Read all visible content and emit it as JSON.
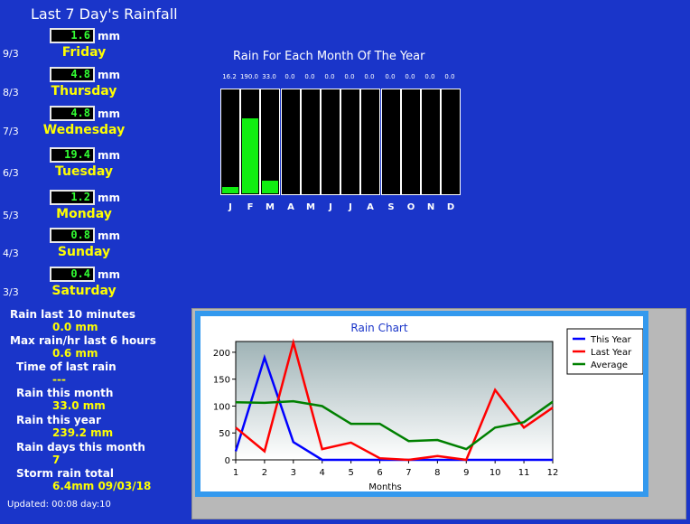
{
  "header": {
    "title": "Last 7 Day's Rainfall"
  },
  "days": [
    {
      "date": "9/3",
      "value": "1.6",
      "unit": "mm",
      "day": "Friday"
    },
    {
      "date": "8/3",
      "value": "4.8",
      "unit": "mm",
      "day": "Thursday"
    },
    {
      "date": "7/3",
      "value": "4.8",
      "unit": "mm",
      "day": "Wednesday"
    },
    {
      "date": "6/3",
      "value": "19.4",
      "unit": "mm",
      "day": "Tuesday"
    },
    {
      "date": "5/3",
      "value": "1.2",
      "unit": "mm",
      "day": "Monday"
    },
    {
      "date": "4/3",
      "value": "0.8",
      "unit": "mm",
      "day": "Sunday"
    },
    {
      "date": "3/3",
      "value": "0.4",
      "unit": "mm",
      "day": "Saturday"
    }
  ],
  "stats": [
    {
      "label": "Rain last 10 minutes",
      "value": "0.0 mm"
    },
    {
      "label": "Max rain/hr last 6 hours",
      "value": "0.6 mm"
    },
    {
      "label": "Time of last rain",
      "value": "---"
    },
    {
      "label": "Rain this month",
      "value": "33.0 mm"
    },
    {
      "label": "Rain this year",
      "value": "239.2 mm"
    },
    {
      "label": "Rain days this month",
      "value": "7"
    },
    {
      "label": "Storm rain total",
      "value": "6.4mm 09/03/18"
    }
  ],
  "footer": {
    "updated": "Updated: 00:08 day:10"
  },
  "colors": {
    "background": "#1a35c9",
    "value_text": "#33ff33",
    "day_text": "#ffff00",
    "bar": "#11ee11",
    "this_year": "#0000ff",
    "last_year": "#ff0000",
    "average": "#008000"
  },
  "monthly": {
    "title": "Rain For Each Month Of The Year",
    "labels": [
      "J",
      "F",
      "M",
      "A",
      "M",
      "J",
      "J",
      "A",
      "S",
      "O",
      "N",
      "D"
    ],
    "value_labels": [
      "16.2",
      "190.0",
      "33.0",
      "0.0",
      "0.0",
      "0.0",
      "0.0",
      "0.0",
      "0.0",
      "0.0",
      "0.0",
      "0.0"
    ],
    "values": [
      16.2,
      190.0,
      33.0,
      0,
      0,
      0,
      0,
      0,
      0,
      0,
      0,
      0
    ],
    "max": 265
  },
  "chart_data": {
    "type": "line",
    "title": "Rain Chart",
    "xlabel": "Months",
    "ylabel": "",
    "x": [
      1,
      2,
      3,
      4,
      5,
      6,
      7,
      8,
      9,
      10,
      11,
      12
    ],
    "xlim": [
      1,
      12
    ],
    "ylim": [
      0,
      220
    ],
    "yticks": [
      0,
      50,
      100,
      150,
      200
    ],
    "grid": false,
    "legend": "top-right",
    "series": [
      {
        "name": "This Year",
        "color": "#0000ff",
        "values": [
          16,
          190,
          33,
          0,
          0,
          0,
          0,
          0,
          0,
          0,
          0,
          0
        ]
      },
      {
        "name": "Last Year",
        "color": "#ff0000",
        "values": [
          60,
          16,
          218,
          20,
          32,
          3,
          0,
          7,
          0,
          130,
          60,
          97
        ]
      },
      {
        "name": "Average",
        "color": "#008000",
        "values": [
          107,
          106,
          109,
          100,
          67,
          67,
          35,
          37,
          20,
          60,
          70,
          108
        ]
      }
    ]
  }
}
